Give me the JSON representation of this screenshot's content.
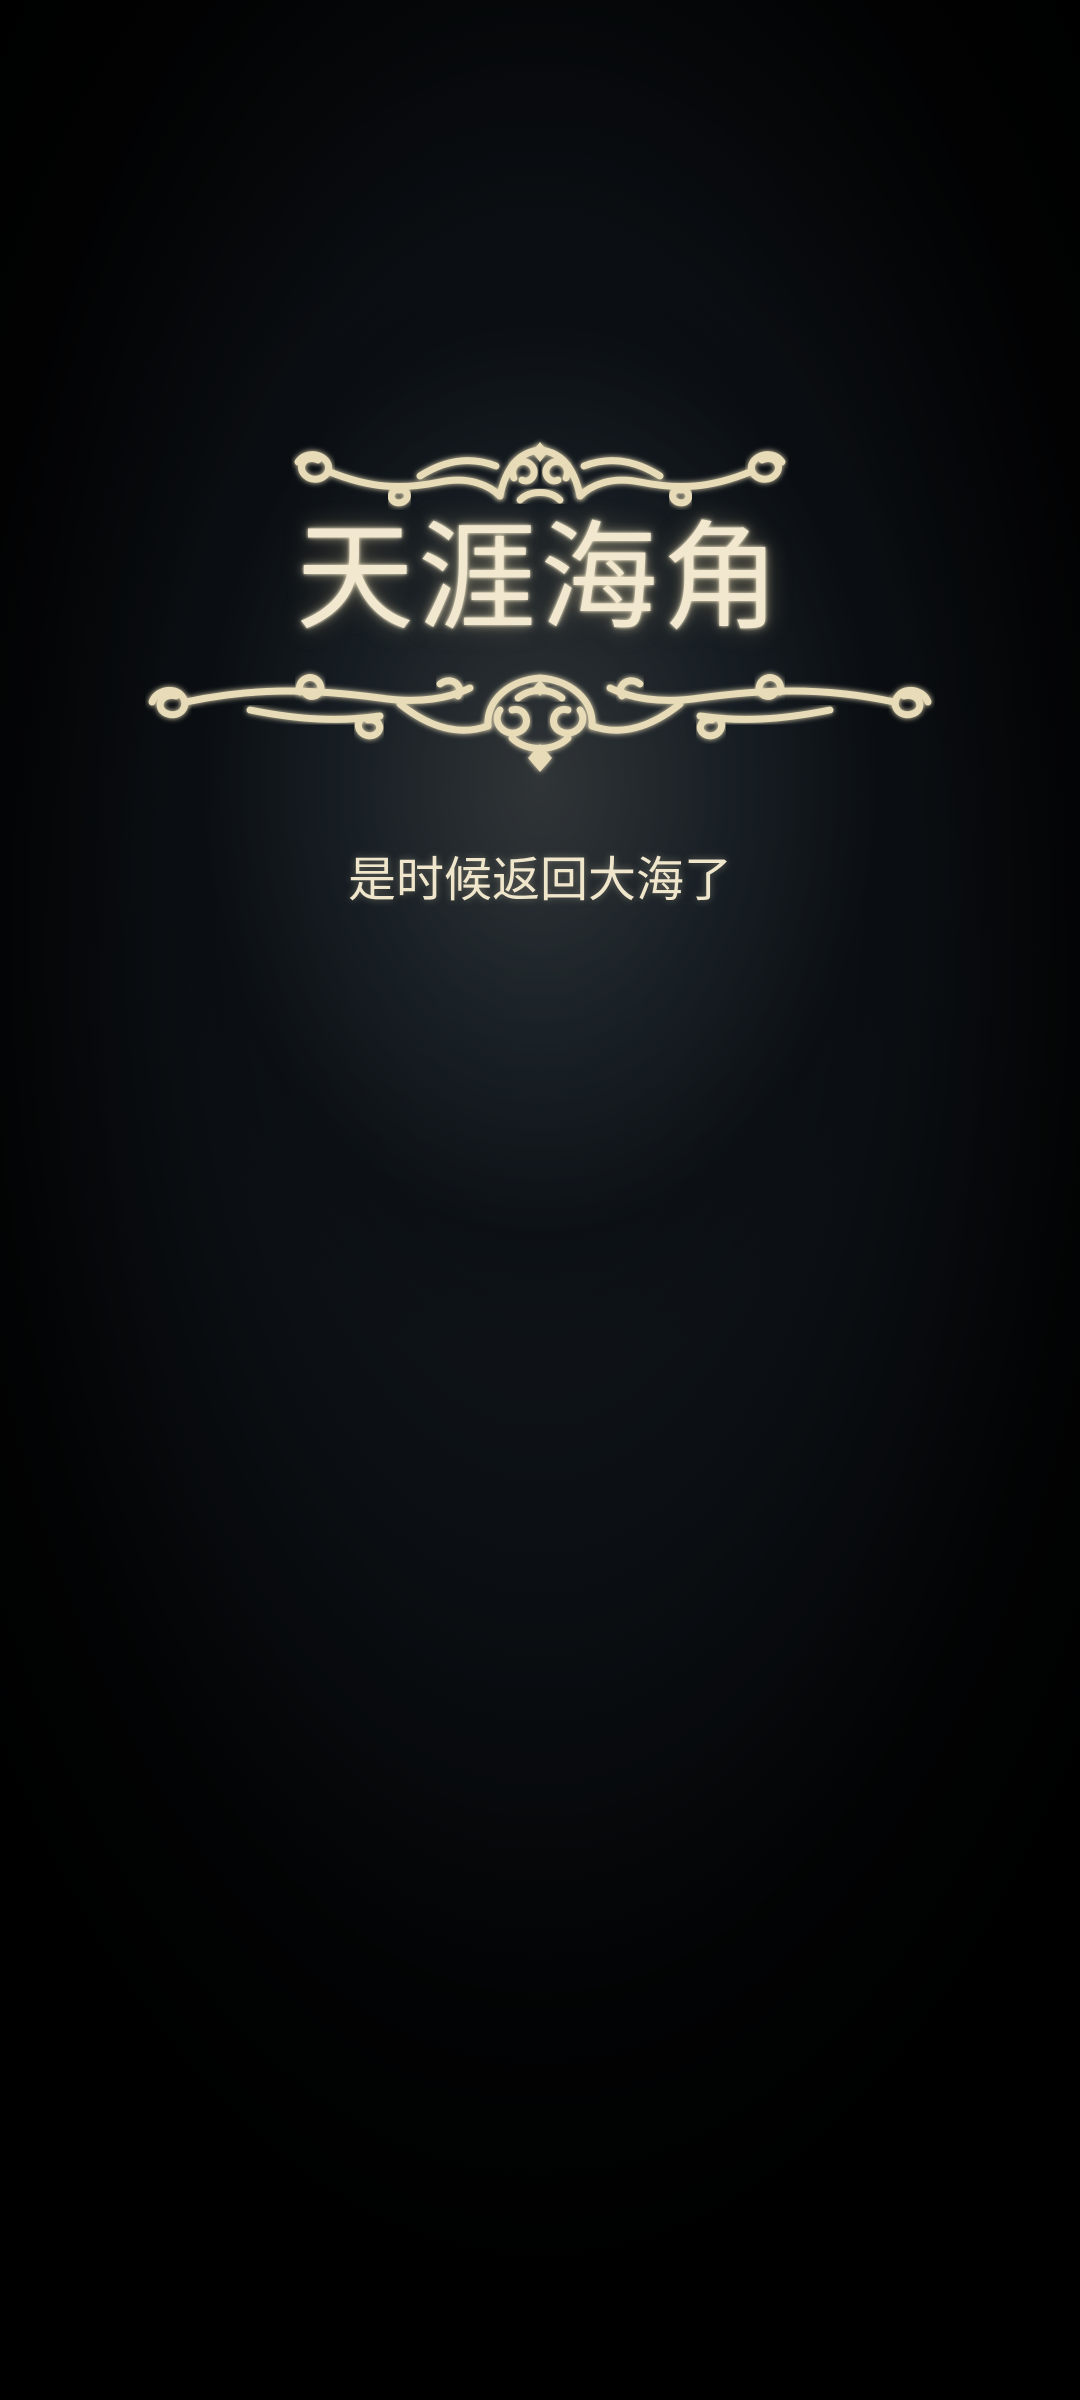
{
  "title": "天涯海角",
  "subtitle": "是时候返回大海了",
  "colors": {
    "text": "#f1e8cf",
    "ornament": "#e8dcb8",
    "background_center": "#2a2f30",
    "background_edge": "#000000"
  },
  "icons": {
    "top": "ornamental-flourish-icon",
    "bottom": "ornamental-flourish-icon"
  }
}
